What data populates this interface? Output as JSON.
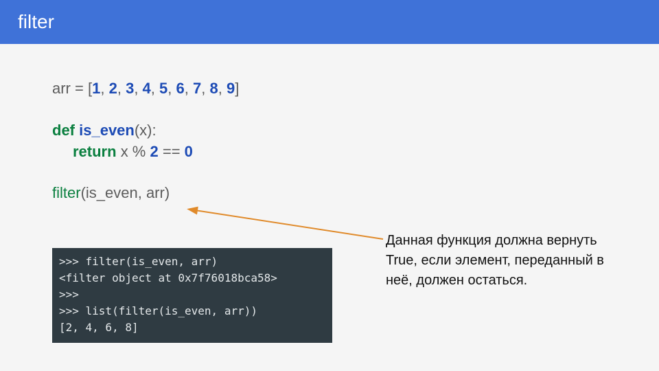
{
  "header": {
    "title": "filter"
  },
  "code": {
    "arr_name": "arr",
    "eq": " = ",
    "lbr": "[",
    "rbr": "]",
    "comma": ", ",
    "values": [
      "1",
      "2",
      "3",
      "4",
      "5",
      "6",
      "7",
      "8",
      "9"
    ],
    "def_kw": "def ",
    "fn_name": "is_even",
    "fn_params": "(x):",
    "return_kw": "return ",
    "return_body_a": "x % ",
    "mod_val": "2",
    "return_body_b": " == ",
    "eq_val": "0",
    "call_fn": "filter",
    "call_args": "(is_even, arr)"
  },
  "terminal": {
    "line1": ">>> filter(is_even, arr)",
    "line2": "<filter object at 0x7f76018bca58>",
    "line3": ">>>",
    "line4": ">>> list(filter(is_even, arr))",
    "line5": "[2, 4, 6, 8]"
  },
  "annotation": {
    "text": "Данная функция должна вернуть True, если элемент, переданный в неё, должен остаться."
  }
}
